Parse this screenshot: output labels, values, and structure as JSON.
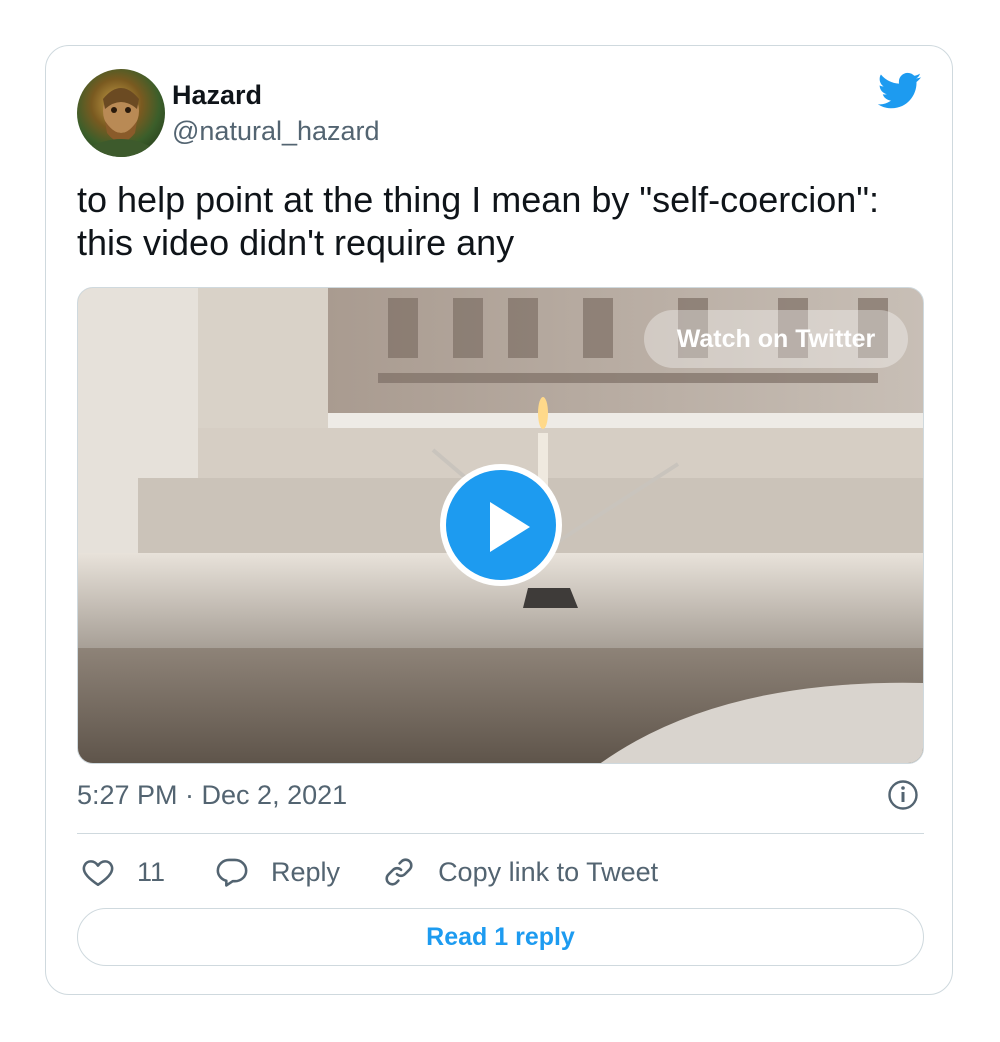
{
  "tweet": {
    "author_name": "Hazard",
    "author_handle": "@natural_hazard",
    "text": "to help point at the thing I mean by \"self-coercion\": this video didn't require any",
    "timestamp": "5:27 PM · Dec 2, 2021",
    "watch_label": "Watch on Twitter",
    "likes": "11",
    "reply_label": "Reply",
    "copy_label": "Copy link to Tweet",
    "read_replies_label": "Read 1 reply"
  },
  "icons": {
    "brand": "twitter-bird-icon",
    "play": "play-icon",
    "info": "info-icon",
    "like": "heart-icon",
    "reply": "speech-bubble-icon",
    "copy": "link-icon"
  },
  "colors": {
    "accent": "#1d9bf0",
    "secondary_text": "#536471",
    "border": "#cfd9de",
    "text": "#0f1419"
  }
}
